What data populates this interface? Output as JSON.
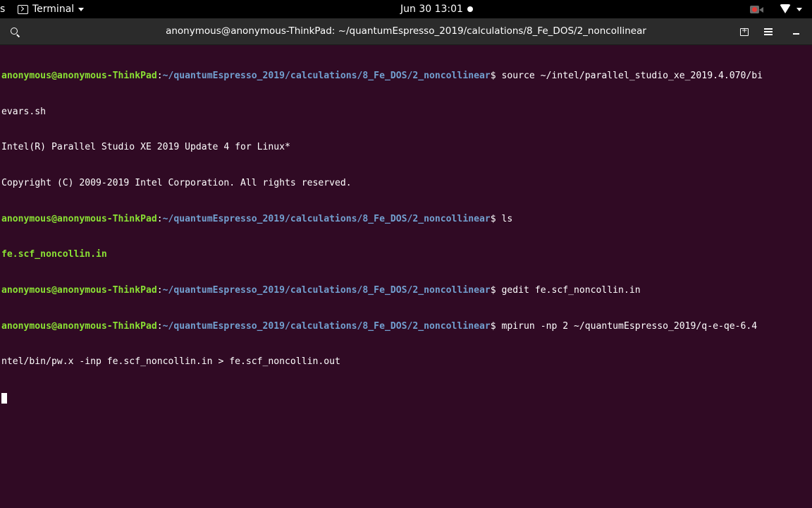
{
  "topbar": {
    "activities_stub": "s",
    "app_menu_label": "Terminal",
    "clock": "Jun 30  13:01",
    "icons": [
      "terminal-icon",
      "chevron-down-icon",
      "screen-record-icon",
      "wifi-icon",
      "chevron-down-icon"
    ]
  },
  "window": {
    "title": "anonymous@anonymous-ThinkPad: ~/quantumEspresso_2019/calculations/8_Fe_DOS/2_noncollinear",
    "icons": [
      "search-icon",
      "new-tab-icon",
      "hamburger-menu-icon",
      "minimize-icon"
    ]
  },
  "terminal": {
    "prompt_user": "anonymous@anonymous-ThinkPad",
    "prompt_colon": ":",
    "prompt_path": "~/quantumEspresso_2019/calculations/8_Fe_DOS/2_noncollinear",
    "prompt_dollar": "$ ",
    "commands": [
      "source ~/intel/parallel_studio_xe_2019.4.070/bi",
      "ls",
      "gedit fe.scf_noncollin.in",
      "mpirun -np 2 ~/quantumEspresso_2019/q-e-qe-6.4"
    ],
    "output": {
      "wrap_1": "evars.sh",
      "intel_banner": "Intel(R) Parallel Studio XE 2019 Update 4 for Linux*",
      "copyright": "Copyright (C) 2009-2019 Intel Corporation. All rights reserved.",
      "ls_entry": "fe.scf_noncollin.in",
      "wrap_2": "ntel/bin/pw.x -inp fe.scf_noncollin.in > fe.scf_noncollin.out"
    }
  },
  "colors": {
    "terminal_bg": "#300a24",
    "prompt_user": "#8ae234",
    "prompt_path": "#729fcf",
    "topbar_bg": "#000000",
    "titlebar_bg": "#2b2b2b"
  }
}
